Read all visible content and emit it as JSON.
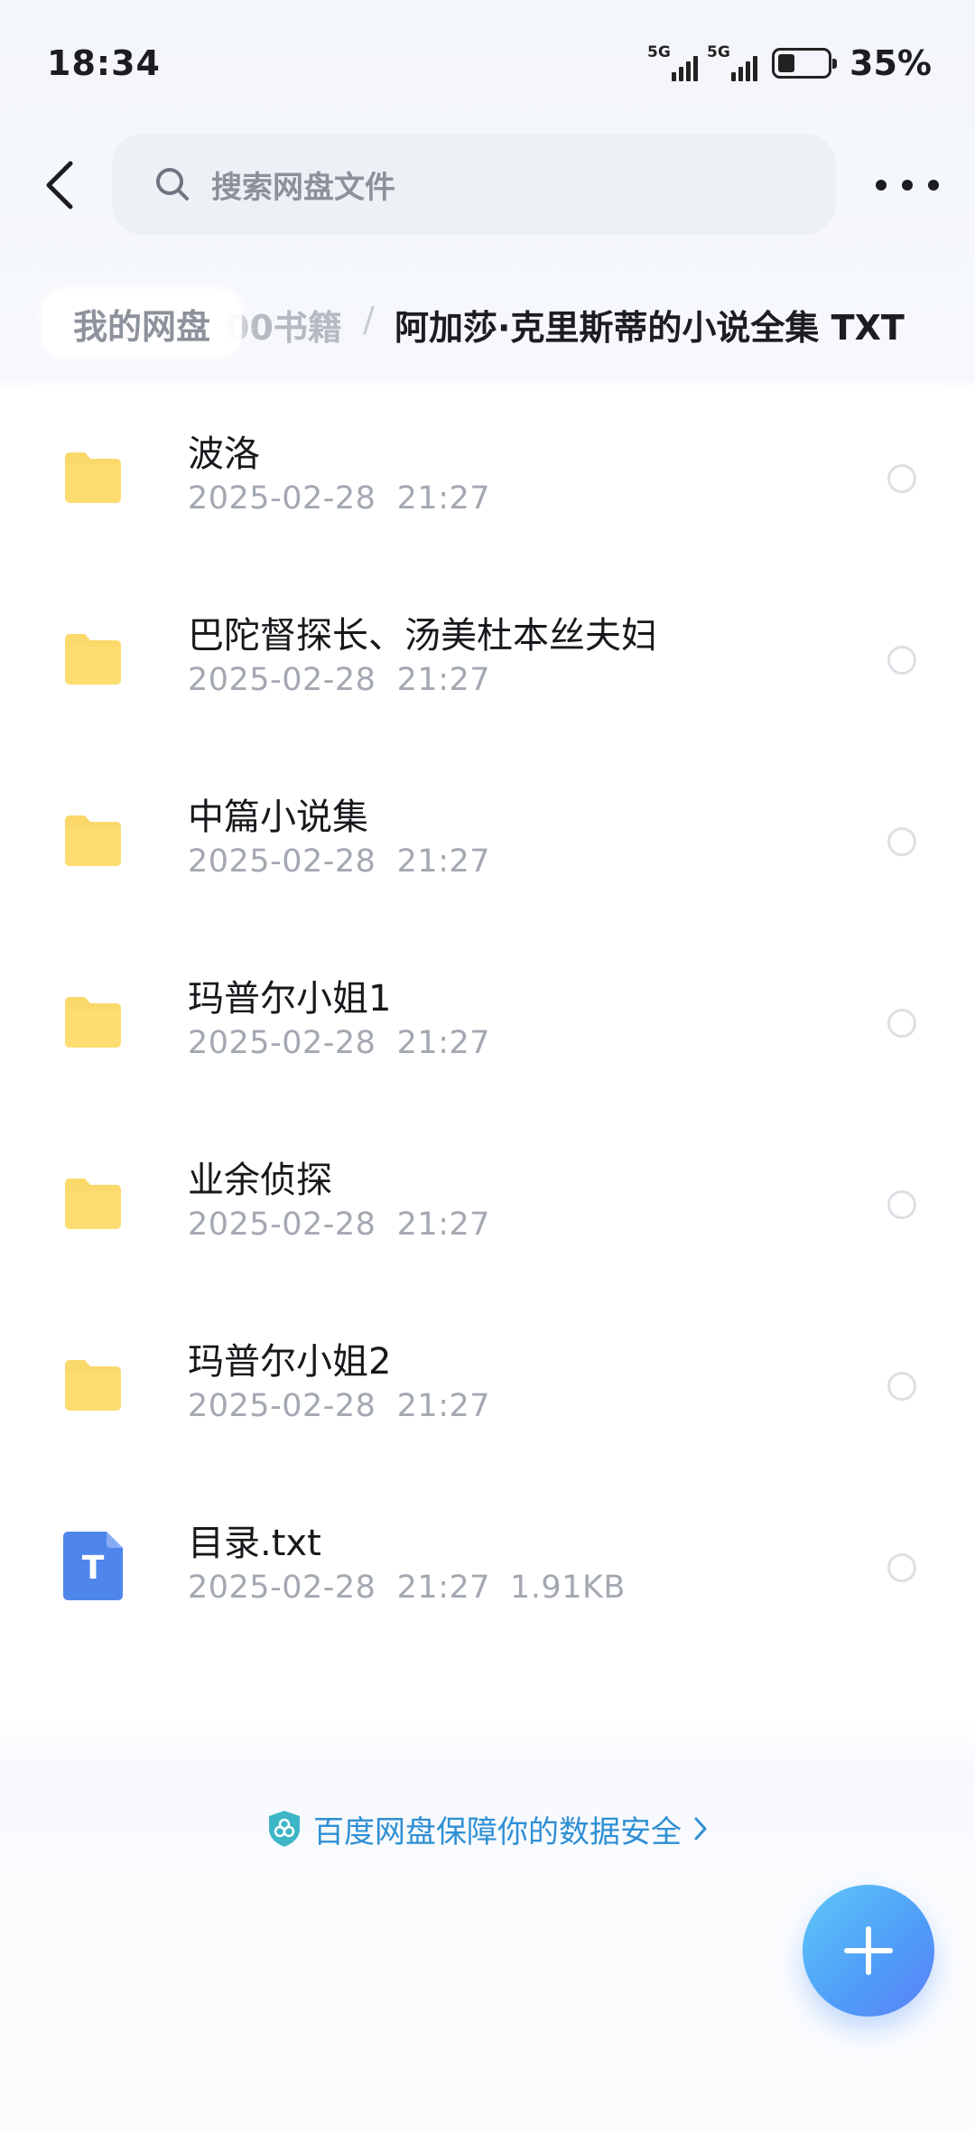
{
  "status_bar": {
    "time": "18:34",
    "signal_1": "5G",
    "signal_2": "5G",
    "battery_level": 0.35,
    "battery_text": "35%"
  },
  "header": {
    "search_placeholder": "搜索网盘文件",
    "back_icon": "chevron-left-icon",
    "more_icon": "more-dots-icon"
  },
  "breadcrumb": {
    "root": "我的网盘",
    "middle": "00书籍",
    "separator": "/",
    "current": "阿加莎·克里斯蒂的小说全集 TXT"
  },
  "files": [
    {
      "name": "波洛",
      "date": "2025-02-28  21:27",
      "size": "",
      "type": "folder"
    },
    {
      "name": "巴陀督探长、汤美杜本丝夫妇",
      "date": "2025-02-28  21:27",
      "size": "",
      "type": "folder"
    },
    {
      "name": "中篇小说集",
      "date": "2025-02-28  21:27",
      "size": "",
      "type": "folder"
    },
    {
      "name": "玛普尔小姐1",
      "date": "2025-02-28  21:27",
      "size": "",
      "type": "folder"
    },
    {
      "name": "业余侦探",
      "date": "2025-02-28  21:27",
      "size": "",
      "type": "folder"
    },
    {
      "name": "玛普尔小姐2",
      "date": "2025-02-28  21:27",
      "size": "",
      "type": "folder"
    },
    {
      "name": "目录.txt",
      "date": "2025-02-28  21:27",
      "size": "1.91KB",
      "type": "txt"
    }
  ],
  "safety_banner": {
    "text": "百度网盘保障你的数据安全",
    "icon": "shield-icon"
  },
  "fab": {
    "icon": "plus-icon"
  },
  "colors": {
    "folder": "#fbd86a",
    "txt_file": "#4f86ec",
    "accent": "#2f8fd4"
  }
}
